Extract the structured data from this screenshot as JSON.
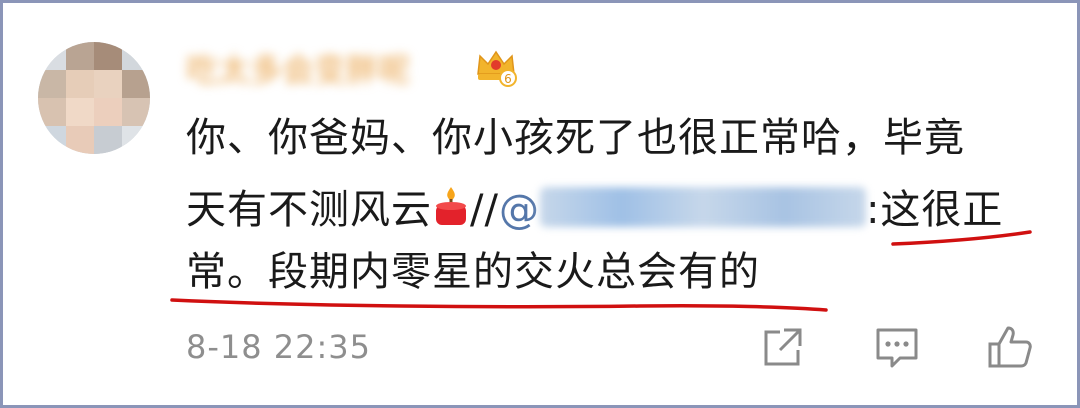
{
  "comment": {
    "timestamp": "8-18 22:35",
    "line1": "你、你爸妈、你小孩死了也很正常哈，毕竟",
    "line2_before": "天有不测风云",
    "line2_sep": "//",
    "line2_at": "@",
    "line2_after": ":这很正",
    "line3": "常。段期内零星的交火总会有的"
  },
  "icons": {
    "badge": "crown-level-badge-icon",
    "emoji": "cake-candle-icon",
    "share": "share-icon",
    "reply": "comment-icon",
    "like": "thumbs-up-icon"
  },
  "colors": {
    "username": "#e9a34a",
    "mention": "#5577aa",
    "underline": "#d01010",
    "timestamp": "#8e8e8e"
  }
}
